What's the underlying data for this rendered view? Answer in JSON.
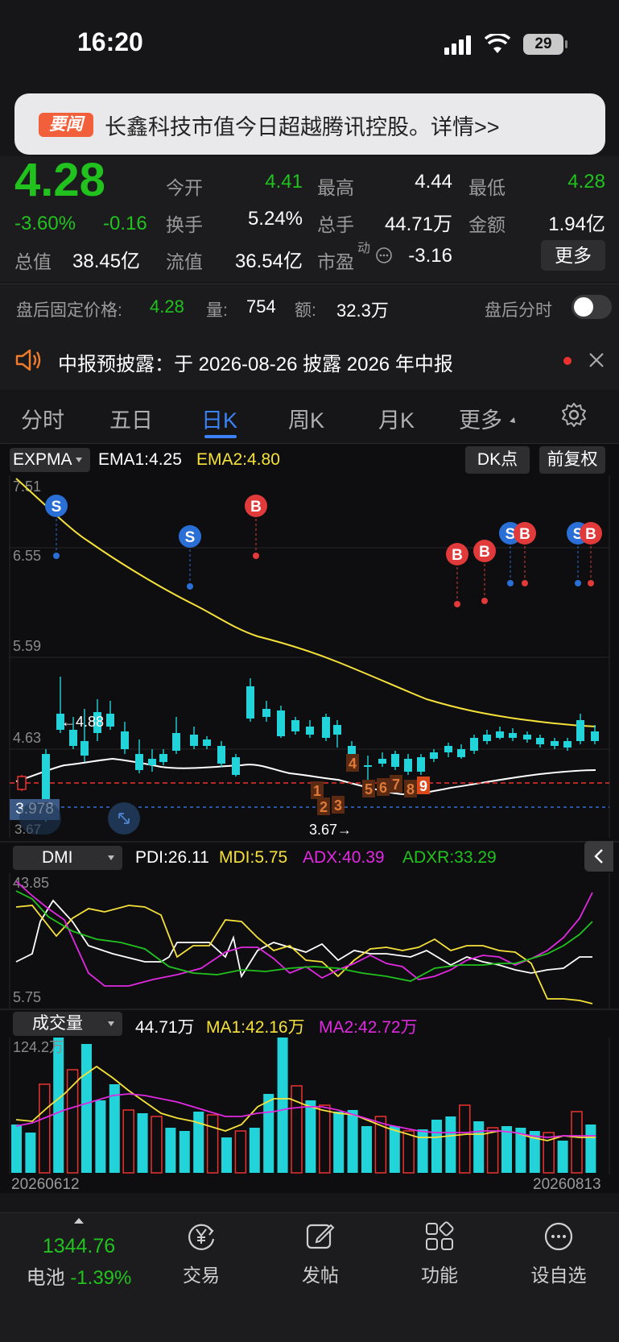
{
  "status_bar": {
    "time": "16:20",
    "battery": "29"
  },
  "news_banner": {
    "tag": "要闻",
    "text": "长鑫科技市值今日超越腾讯控股。详情>>"
  },
  "quote": {
    "price": "4.28",
    "change_pct": "-3.60%",
    "change": "-0.16",
    "fields": {
      "open_label": "今开",
      "open": "4.41",
      "high_label": "最高",
      "high": "4.44",
      "low_label": "最低",
      "low": "4.28",
      "turnover_label": "换手",
      "turnover": "5.24%",
      "volume_label": "总手",
      "volume": "44.71万",
      "amount_label": "金额",
      "amount": "1.94亿",
      "mcap_label": "总值",
      "mcap": "38.45亿",
      "float_label": "流值",
      "float": "36.54亿",
      "pe_label": "市盈",
      "pe_sup": "动",
      "pe": "-3.16"
    },
    "more_button": "更多"
  },
  "after_hours": {
    "price_label": "盘后固定价格:",
    "price": "4.28",
    "vol_label": "量:",
    "vol": "754",
    "amt_label": "额:",
    "amt": "32.3万",
    "toggle_label": "盘后分时"
  },
  "notice": {
    "text": "中报预披露：于 2026-08-26 披露 2026 年中报"
  },
  "tabs": [
    "分时",
    "五日",
    "日K",
    "周K",
    "月K",
    "更多"
  ],
  "active_tab": "日K",
  "main_chart": {
    "indicator": "EXPMA",
    "ema1": "EMA1:4.25",
    "ema2": "EMA2:4.80",
    "dk_button": "DK点",
    "adjust_button": "前复权",
    "y_ticks": [
      "7.51",
      "6.55",
      "5.59",
      "4.63",
      "3.978",
      "3.67"
    ],
    "high_mark": "←4.88",
    "low_mark": "3.67→",
    "signals": [
      "S",
      "S",
      "B",
      "B",
      "B",
      "S",
      "B",
      "S",
      "B"
    ],
    "sequence_labels": [
      "1",
      "2",
      "3",
      "4",
      "5",
      "6",
      "7",
      "8",
      "9"
    ]
  },
  "dmi_panel": {
    "indicator": "DMI",
    "pdi": "PDI:26.11",
    "mdi": "MDI:5.75",
    "adx": "ADX:40.39",
    "adxr": "ADXR:33.29",
    "y_top": "43.85",
    "y_bottom": "5.75"
  },
  "volume_panel": {
    "indicator": "成交量",
    "vol": "44.71万",
    "ma1": "MA1:42.16万",
    "ma2": "MA2:42.72万",
    "y_top": "124.2万",
    "date_start": "20260612",
    "date_end": "20260813"
  },
  "bottom_nav": {
    "index_value": "1344.76",
    "index_name": "电池",
    "index_change": "-1.39%",
    "items": [
      "交易",
      "发帖",
      "功能",
      "设自选"
    ]
  },
  "colors": {
    "up": "#e8322f",
    "down": "#22d3da",
    "green": "#21c21e",
    "ema2": "#f5e13a",
    "blue": "#3b82f6"
  }
}
